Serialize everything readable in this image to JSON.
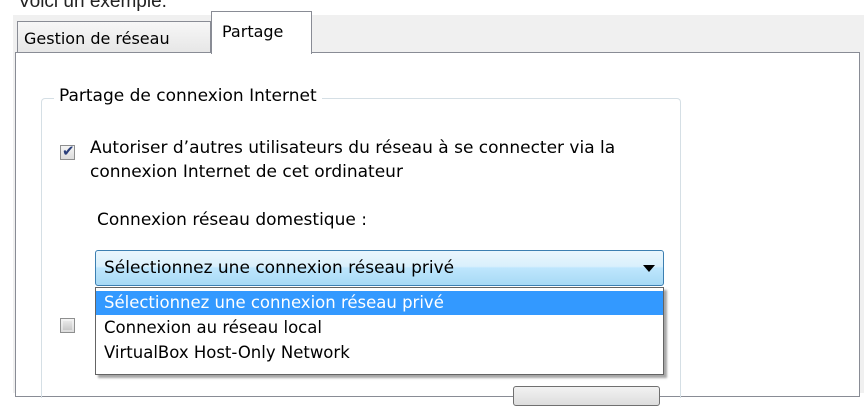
{
  "caption": "Voici un exemple.",
  "tabs": [
    {
      "label": "Gestion de réseau",
      "active": false
    },
    {
      "label": "Partage",
      "active": true
    }
  ],
  "group": {
    "title": "Partage de connexion Internet",
    "allow_checkbox": {
      "checked": true,
      "label": "Autoriser d’autres utilisateurs du réseau à se connecter via la connexion Internet de cet ordinateur"
    },
    "home_network": {
      "label": "Connexion réseau domestique :",
      "selected": "Sélectionnez une connexion réseau privé",
      "options": [
        "Sélectionnez une connexion réseau privé",
        "Connexion au réseau local",
        "VirtualBox Host-Only Network"
      ]
    },
    "second_checkbox": {
      "checked": false
    }
  },
  "colors": {
    "selection": "#3399ff",
    "combo_border": "#3c7fb1",
    "check": "#2a3f7b"
  }
}
